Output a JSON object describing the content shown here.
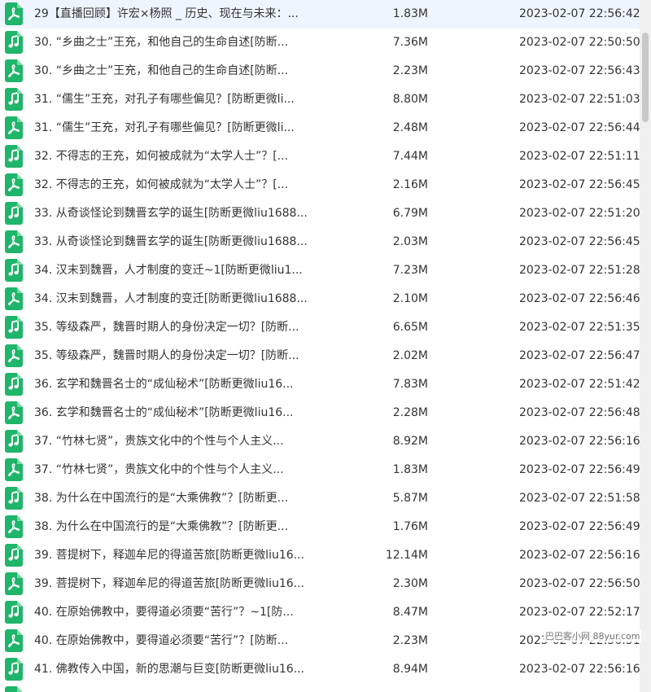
{
  "rows": [
    {
      "type": "pdf",
      "name": "29【直播回顾】许宏×杨照 _ 历史、现在与未来：...",
      "size": "1.83M",
      "date": "2023-02-07 22:56:42"
    },
    {
      "type": "audio",
      "name": "30. “乡曲之士”王充，和他自己的生命自述[防断...",
      "size": "7.36M",
      "date": "2023-02-07 22:50:50"
    },
    {
      "type": "pdf",
      "name": "30. “乡曲之士”王充，和他自己的生命自述[防断...",
      "size": "2.23M",
      "date": "2023-02-07 22:56:43"
    },
    {
      "type": "audio",
      "name": "31. “儒生”王充，对孔子有哪些偏见？[防断更微li...",
      "size": "8.80M",
      "date": "2023-02-07 22:51:03"
    },
    {
      "type": "pdf",
      "name": "31. “儒生”王充，对孔子有哪些偏见？[防断更微li...",
      "size": "2.48M",
      "date": "2023-02-07 22:56:44"
    },
    {
      "type": "audio",
      "name": "32. 不得志的王充，如何被成就为“太学人士”？[...",
      "size": "7.44M",
      "date": "2023-02-07 22:51:11"
    },
    {
      "type": "pdf",
      "name": "32. 不得志的王充，如何被成就为“太学人士”？[...",
      "size": "2.16M",
      "date": "2023-02-07 22:56:45"
    },
    {
      "type": "audio",
      "name": "33. 从奇谈怪论到魏晋玄学的诞生[防断更微liu1688...",
      "size": "6.79M",
      "date": "2023-02-07 22:51:20"
    },
    {
      "type": "pdf",
      "name": "33. 从奇谈怪论到魏晋玄学的诞生[防断更微liu1688...",
      "size": "2.03M",
      "date": "2023-02-07 22:56:45"
    },
    {
      "type": "audio",
      "name": "34. 汉末到魏晋，人才制度的变迁~1[防断更微liu1...",
      "size": "7.23M",
      "date": "2023-02-07 22:51:28"
    },
    {
      "type": "pdf",
      "name": "34. 汉末到魏晋，人才制度的变迁[防断更微liu1688...",
      "size": "2.10M",
      "date": "2023-02-07 22:56:46"
    },
    {
      "type": "audio",
      "name": "35. 等级森严，魏晋时期人的身份决定一切？[防断...",
      "size": "6.65M",
      "date": "2023-02-07 22:51:35"
    },
    {
      "type": "pdf",
      "name": "35. 等级森严，魏晋时期人的身份决定一切？[防断...",
      "size": "2.02M",
      "date": "2023-02-07 22:56:47"
    },
    {
      "type": "audio",
      "name": "36. 玄学和魏晋名士的“成仙秘术”[防断更微liu16...",
      "size": "7.83M",
      "date": "2023-02-07 22:51:42"
    },
    {
      "type": "pdf",
      "name": "36. 玄学和魏晋名士的“成仙秘术”[防断更微liu16...",
      "size": "2.28M",
      "date": "2023-02-07 22:56:48"
    },
    {
      "type": "audio",
      "name": "37. “竹林七贤”，贵族文化中的个性与个人主义...",
      "size": "8.92M",
      "date": "2023-02-07 22:56:16"
    },
    {
      "type": "pdf",
      "name": "37. “竹林七贤”，贵族文化中的个性与个人主义...",
      "size": "1.83M",
      "date": "2023-02-07 22:56:49"
    },
    {
      "type": "audio",
      "name": "38. 为什么在中国流行的是“大乘佛教”？[防断更...",
      "size": "5.87M",
      "date": "2023-02-07 22:51:58"
    },
    {
      "type": "pdf",
      "name": "38. 为什么在中国流行的是“大乘佛教”？[防断更...",
      "size": "1.76M",
      "date": "2023-02-07 22:56:49"
    },
    {
      "type": "audio",
      "name": "39. 菩提树下，释迦牟尼的得道苦旅[防断更微liu16...",
      "size": "12.14M",
      "date": "2023-02-07 22:56:16"
    },
    {
      "type": "pdf",
      "name": "39. 菩提树下，释迦牟尼的得道苦旅[防断更微liu16...",
      "size": "2.30M",
      "date": "2023-02-07 22:56:50"
    },
    {
      "type": "audio",
      "name": "40. 在原始佛教中，要得道必须要“苦行”？~1[防...",
      "size": "8.47M",
      "date": "2023-02-07 22:52:17"
    },
    {
      "type": "pdf",
      "name": "40. 在原始佛教中，要得道必须要“苦行”？[防断...",
      "size": "2.23M",
      "date": "2023-02-07 22:56:51"
    },
    {
      "type": "audio",
      "name": "41. 佛教传入中国，新的思潮与巨变[防断更微liu16...",
      "size": "8.94M",
      "date": "2023-02-07 22:56:16"
    }
  ],
  "watermark": "巴巴客小网 88yur.com",
  "colors": {
    "icon_green": "#1fb56a",
    "text": "#333333"
  }
}
